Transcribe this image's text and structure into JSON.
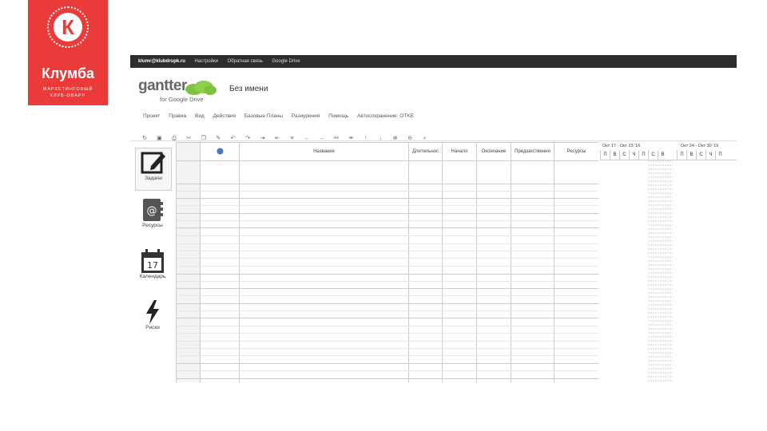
{
  "logo": {
    "letter": "К",
    "brand": "Клумба",
    "tagline_1": "МАРКЕТИНГОВЫЙ",
    "tagline_2": "КЛУБ-ОВАРР"
  },
  "topbar": {
    "email": "klumr@klubdrupk.ru",
    "items": [
      "Настройки",
      "Обратная связь",
      "Google Drive"
    ]
  },
  "app": {
    "logo_text": "gantter",
    "subtitle": "for Google Drive",
    "document_title": "Без имени"
  },
  "menu": [
    "Проект",
    "Правка",
    "Вид",
    "Действия",
    "Базовые Планы",
    "Разнурения",
    "Помощь",
    "Автосохранение: OTKE"
  ],
  "nav": [
    {
      "label": "Задачи",
      "icon": "task-edit-icon",
      "active": true
    },
    {
      "label": "Ресурсы",
      "icon": "resource-book-icon",
      "active": false
    },
    {
      "label": "Календарь",
      "icon": "calendar-icon",
      "active": false,
      "day": "17"
    },
    {
      "label": "Риски",
      "icon": "lightning-icon",
      "active": false
    }
  ],
  "grid": {
    "columns": [
      "Название",
      "Длительнос",
      "Начало",
      "Окончание",
      "Предшественни",
      "Ресурсы"
    ]
  },
  "chart": {
    "week1": "Окт 17 - Окт 23 '16",
    "week2": "Окт 24 - Окт 30 '16",
    "days": [
      "П",
      "В",
      "С",
      "Ч",
      "П",
      "С",
      "В",
      "П",
      "В",
      "С",
      "Ч",
      "П"
    ]
  },
  "colors": {
    "brand_red": "#ea3a3a",
    "topbar": "#2d2d2d",
    "cloud_green": "#7fc241"
  }
}
